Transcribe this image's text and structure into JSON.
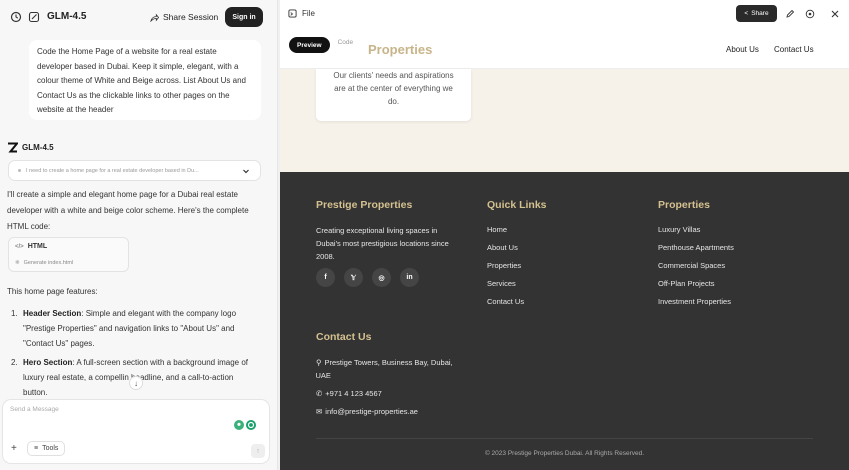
{
  "chat": {
    "model_title": "GLM-4.5",
    "share_session": "Share Session",
    "sign_in": "Sign in",
    "user_message_lines": [
      "Code the Home Page of a website for a real estate",
      "developer based in Dubai. Keep it simple, elegant, with a",
      "colour theme of White and Beige across. List About Us and",
      "Contact Us as the clickable links to other pages on the",
      "website at the header"
    ],
    "assistant_name": "GLM-4.5",
    "thinking_preview": "I need to create a home page for a real estate developer based in Du...",
    "intro_lines": [
      "I'll create a simple and elegant home page for a Dubai real estate",
      "developer with a white and beige color scheme. Here's the complete",
      "HTML code:"
    ],
    "code_card": {
      "title": "HTML",
      "subtitle": "Generate index.html"
    },
    "features_intro": "This home page features:",
    "features": [
      {
        "num": "1.",
        "title": "Header Section",
        "lines": [
          ": Simple and elegant with the company logo",
          "\"Prestige Properties\" and navigation links to \"About Us\" and",
          "\"Contact Us\" pages."
        ]
      },
      {
        "num": "2.",
        "title": "Hero Section",
        "lines": [
          ": A full-screen section with a background image of",
          "luxury real estate, a compellin   headline, and a call-to-action",
          "button."
        ]
      }
    ],
    "composer": {
      "placeholder": "Send a Message",
      "tools": "Tools"
    }
  },
  "preview": {
    "file_label": "File",
    "share": "Share",
    "tabs": {
      "preview": "Preview",
      "code": "Code"
    },
    "site": {
      "logo": "Properties",
      "nav": {
        "about": "About Us",
        "contact": "Contact Us"
      },
      "card_lines": [
        "Our clients' needs and aspirations",
        "are at the center of everything we",
        "do."
      ],
      "footer": {
        "brand_title": "Prestige Properties",
        "brand_lines": [
          "Creating exceptional living spaces in",
          "Dubai's most prestigious locations since",
          "2008."
        ],
        "quick_links_title": "Quick Links",
        "quick_links": [
          "Home",
          "About Us",
          "Properties",
          "Services",
          "Contact Us"
        ],
        "properties_title": "Properties",
        "properties": [
          "Luxury Villas",
          "Penthouse Apartments",
          "Commercial Spaces",
          "Off-Plan Projects",
          "Investment Properties"
        ],
        "contact_title": "Contact Us",
        "address_lines": [
          "Prestige Towers, Business Bay, Dubai,",
          "UAE"
        ],
        "phone": "+971 4 123 4567",
        "email": "info@prestige-properties.ae",
        "copyright": "© 2023 Prestige Properties Dubai. All Rights Reserved."
      }
    }
  },
  "colors": {
    "beige_accent": "#c8b48a",
    "footer_bg": "#333333",
    "footer_heading": "#d4c18f",
    "beige_bg": "#f6f2ea"
  },
  "icons": [
    "history-icon",
    "new-chat-icon",
    "share-icon",
    "z-logo-icon",
    "chevron-down-icon",
    "code-icon",
    "file-icon",
    "edit-icon",
    "settings-icon",
    "close-icon",
    "facebook-icon",
    "twitter-icon",
    "instagram-icon",
    "linkedin-icon",
    "map-pin-icon",
    "phone-icon",
    "mail-icon",
    "plus-icon",
    "tools-icon",
    "send-icon",
    "arrow-down-icon"
  ]
}
